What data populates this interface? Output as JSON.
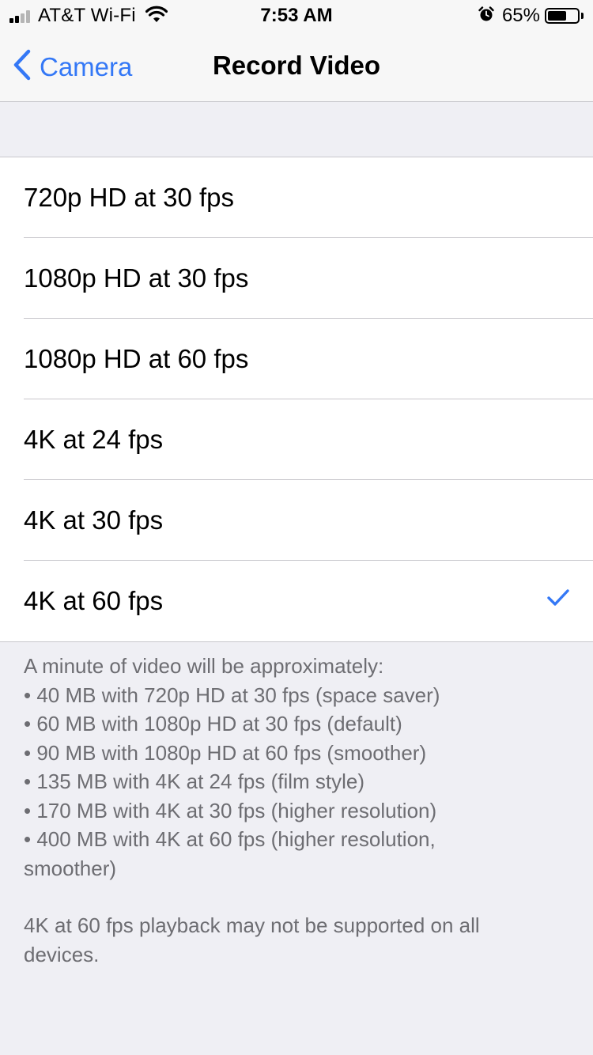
{
  "status_bar": {
    "carrier": "AT&T Wi-Fi",
    "time": "7:53 AM",
    "battery_percent": "65%",
    "battery_level": 0.65,
    "signal_bars": 2,
    "icons": [
      "signal-icon",
      "wifi-icon",
      "alarm-icon",
      "battery-icon"
    ]
  },
  "nav": {
    "back_label": "Camera",
    "title": "Record Video"
  },
  "options": [
    {
      "label": "720p HD at 30 fps",
      "selected": false
    },
    {
      "label": "1080p HD at 30 fps",
      "selected": false
    },
    {
      "label": "1080p HD at 60 fps",
      "selected": false
    },
    {
      "label": "4K at 24 fps",
      "selected": false
    },
    {
      "label": "4K at 30 fps",
      "selected": false
    },
    {
      "label": "4K at 60 fps",
      "selected": true
    }
  ],
  "footer": {
    "intro": "A minute of video will be approximately:",
    "lines": [
      "• 40 MB with 720p HD at 30 fps (space saver)",
      "• 60 MB with 1080p HD at 30 fps (default)",
      "• 90 MB with 1080p HD at 60 fps (smoother)",
      "• 135 MB with 4K at 24 fps (film style)",
      "• 170 MB with 4K at 30 fps (higher resolution)",
      "• 400 MB with 4K at 60 fps (higher resolution, smoother)"
    ],
    "note": "4K at 60 fps playback may not be supported on all devices."
  },
  "colors": {
    "accent": "#3478f6",
    "background": "#efeff4",
    "footer_text": "#6d6d72",
    "separator": "#c8c7cc"
  }
}
